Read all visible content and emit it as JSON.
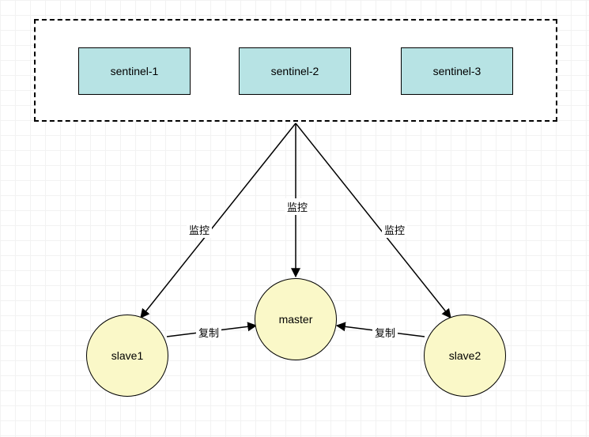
{
  "diagram": {
    "sentinels": [
      {
        "label": "sentinel-1"
      },
      {
        "label": "sentinel-2"
      },
      {
        "label": "sentinel-3"
      }
    ],
    "nodes": {
      "master": {
        "label": "master",
        "color": "#faf8c8"
      },
      "slave1": {
        "label": "slave1",
        "color": "#faf8c8"
      },
      "slave2": {
        "label": "slave2",
        "color": "#faf8c8"
      }
    },
    "edges": {
      "monitor_left": "监控",
      "monitor_mid": "监控",
      "monitor_right": "监控",
      "replicate_left": "复制",
      "replicate_right": "复制"
    }
  }
}
